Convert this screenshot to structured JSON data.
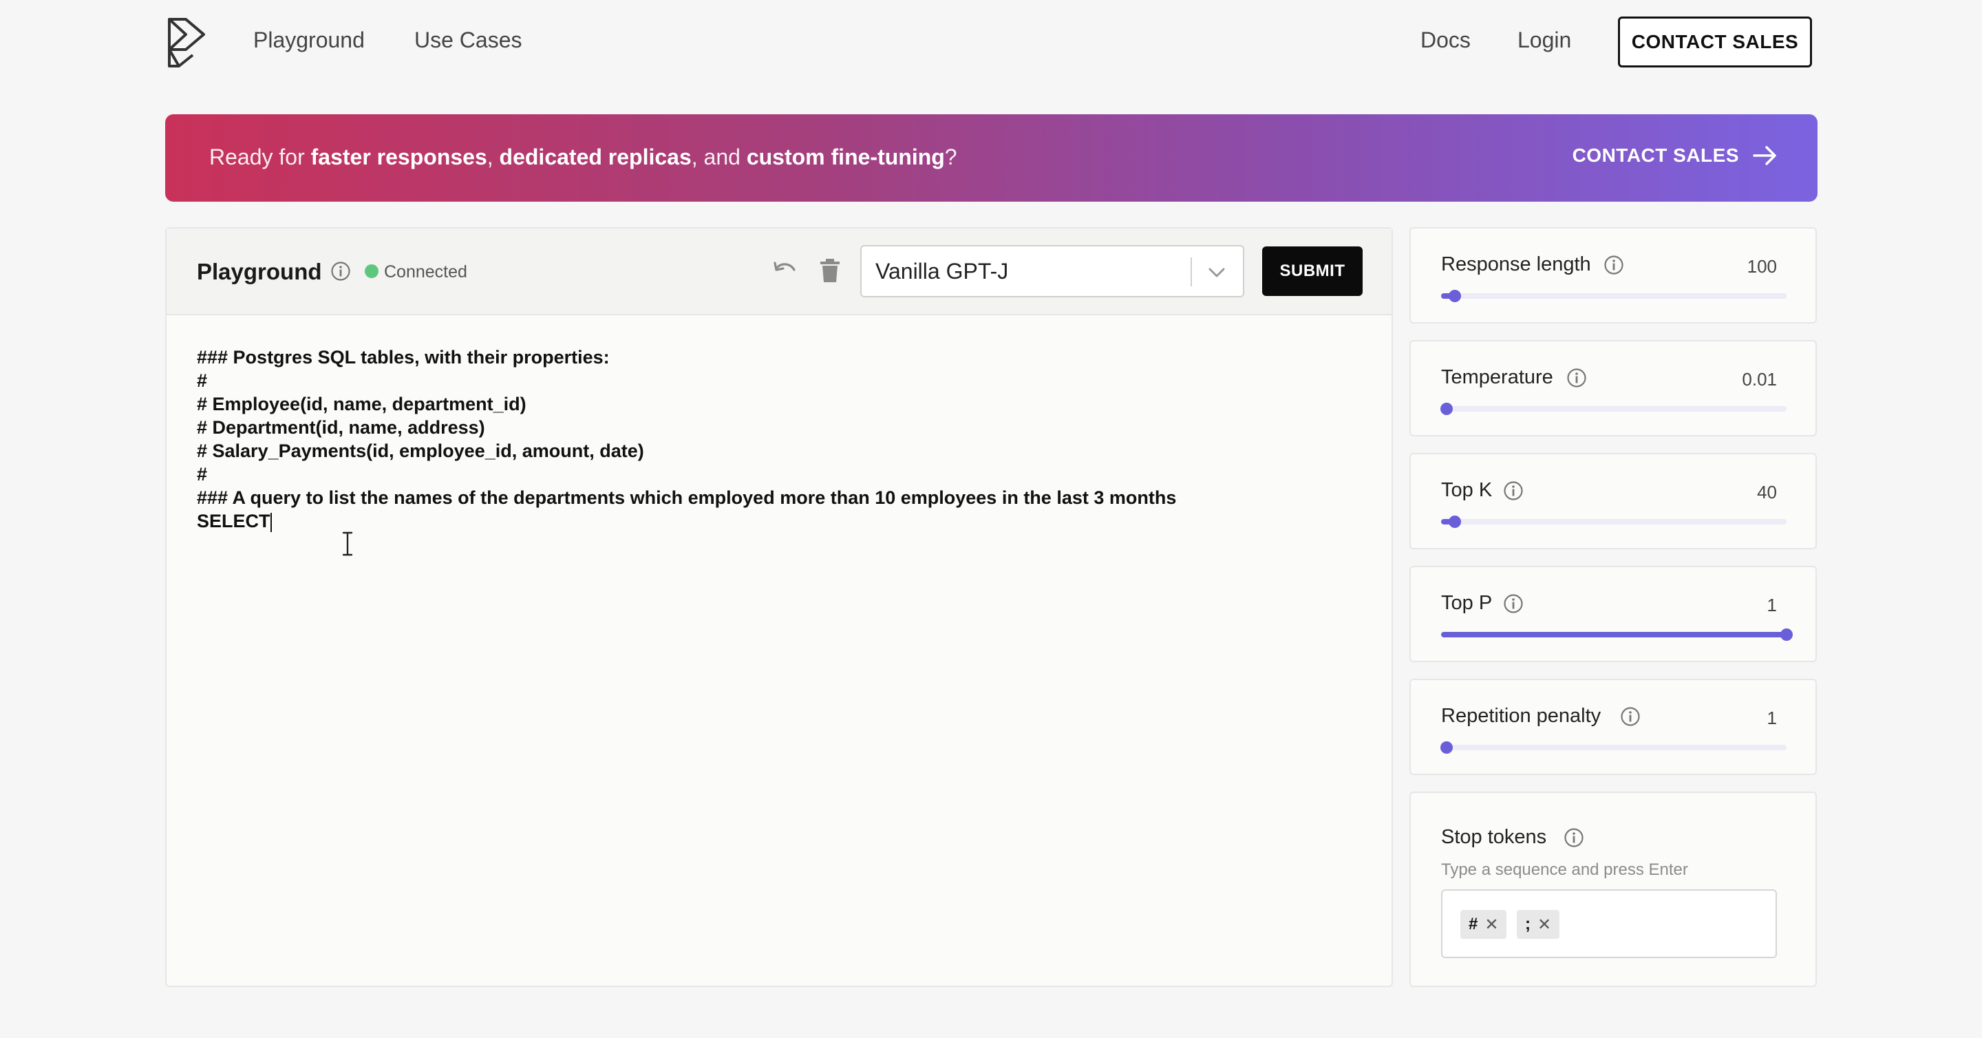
{
  "nav": {
    "links": [
      "Playground",
      "Use Cases"
    ],
    "docs": "Docs",
    "login": "Login",
    "contact_sales": "CONTACT SALES"
  },
  "banner": {
    "prefix": "Ready for ",
    "bold1": "faster responses",
    "sep1": ", ",
    "bold2": "dedicated replicas",
    "sep2": ", and ",
    "bold3": "custom fine-tuning",
    "suffix": "?",
    "cta": "CONTACT SALES"
  },
  "playground": {
    "title": "Playground",
    "status": "Connected",
    "model": "Vanilla GPT-J",
    "submit": "SUBMIT",
    "prompt_lines": [
      "### Postgres SQL tables, with their properties:",
      "#",
      "# Employee(id, name, department_id)",
      "# Department(id, name, address)",
      "# Salary_Payments(id, employee_id, amount, date)",
      "#",
      "### A query to list the names of the departments which employed more than 10 employees in the last 3 months",
      "SELECT"
    ]
  },
  "settings": [
    {
      "label": "Response length",
      "value": "100",
      "fraction": 0.04
    },
    {
      "label": "Temperature",
      "value": "0.01",
      "fraction": 0.0
    },
    {
      "label": "Top K",
      "value": "40",
      "fraction": 0.04
    },
    {
      "label": "Top P",
      "value": "1",
      "fraction": 1.0
    },
    {
      "label": "Repetition penalty",
      "value": "1",
      "fraction": 0.0
    }
  ],
  "stop_tokens": {
    "label": "Stop tokens",
    "hint": "Type a sequence and press Enter",
    "tokens": [
      "#",
      ";"
    ]
  },
  "colors": {
    "accent": "#6a5fd9",
    "status_green": "#5fc77d",
    "banner_start": "#c8325a",
    "banner_end": "#7b63e0"
  }
}
